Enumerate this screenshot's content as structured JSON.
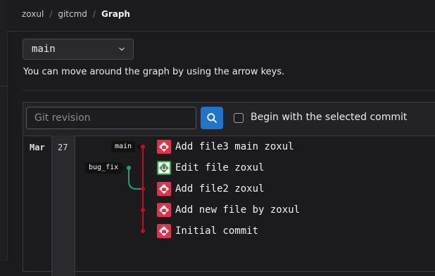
{
  "breadcrumb": {
    "items": [
      "zoxul",
      "gitcmd"
    ],
    "current": "Graph"
  },
  "branch_select": {
    "value": "main"
  },
  "hint": "You can move around the graph by using the arrow keys.",
  "search": {
    "placeholder": "Git revision",
    "checkbox_label": "Begin with the selected commit",
    "checkbox_checked": false
  },
  "dates": {
    "month": "Mar",
    "day": "27"
  },
  "refs": [
    {
      "label": "main",
      "color": "#111111"
    },
    {
      "label": "bug_fix",
      "color": "#111111"
    }
  ],
  "commits": [
    {
      "message": "Add file3 main zoxul",
      "avatar": "red"
    },
    {
      "message": "Edit file zoxul",
      "avatar": "green"
    },
    {
      "message": "Add file2 zoxul",
      "avatar": "red"
    },
    {
      "message": "Add new file by zoxul",
      "avatar": "red"
    },
    {
      "message": "Initial commit",
      "avatar": "red"
    }
  ],
  "colors": {
    "main_line": "#cc0a1e",
    "bug_fix_line": "#1aa37a",
    "button": "#1f75cb",
    "avatar_red": "#e0334a",
    "avatar_green": "#2aa84a"
  }
}
